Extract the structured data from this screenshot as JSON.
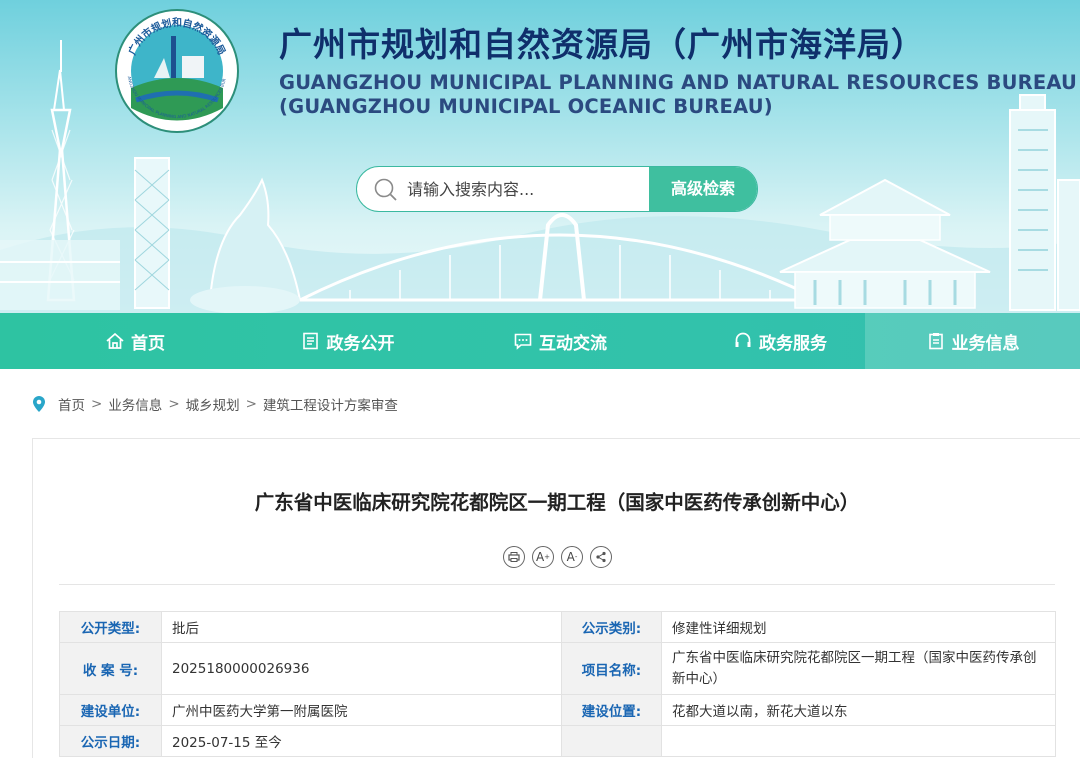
{
  "header": {
    "title_cn": "广州市规划和自然资源局（广州市海洋局）",
    "title_en_line1": "GUANGZHOU MUNICIPAL PLANNING AND NATURAL RESOURCES BUREAU",
    "title_en_line2": "(GUANGZHOU MUNICIPAL OCEANIC BUREAU)",
    "emblem_text": "广州市规划和自然资源局",
    "emblem_text_en": "GUANGZHOU MUNICIPAL PLANNING AND NATURAL RESOURCES BUREAU"
  },
  "search": {
    "placeholder": "请输入搜索内容...",
    "advanced_label": "高级检索"
  },
  "nav": {
    "items": [
      {
        "label": "首页",
        "icon": "home-icon"
      },
      {
        "label": "政务公开",
        "icon": "document-icon"
      },
      {
        "label": "互动交流",
        "icon": "chat-icon"
      },
      {
        "label": "政务服务",
        "icon": "headset-icon"
      },
      {
        "label": "业务信息",
        "icon": "clipboard-icon",
        "active": true
      }
    ]
  },
  "breadcrumb": {
    "items": [
      "首页",
      "业务信息",
      "城乡规划",
      "建筑工程设计方案审查"
    ],
    "separator": ">"
  },
  "article": {
    "title": "广东省中医临床研究院花都院区一期工程（国家中医药传承创新中心）",
    "tools": [
      "print-icon",
      "font-larger-icon",
      "font-smaller-icon",
      "share-icon"
    ],
    "tool_glyphs": {
      "font_larger": "A",
      "font_smaller": "A"
    }
  },
  "info_table": {
    "public_type_label": "公开类型:",
    "public_type_value": "批后",
    "notice_category_label": "公示类别:",
    "notice_category_value": "修建性详细规划",
    "case_no_label": "收 案 号:",
    "case_no_value": "2025180000026936",
    "project_name_label": "项目名称:",
    "project_name_value": "广东省中医临床研究院花都院区一期工程（国家中医药传承创新中心）",
    "builder_label": "建设单位:",
    "builder_value": "广州中医药大学第一附属医院",
    "location_label": "建设位置:",
    "location_value": "花都大道以南，新花大道以东",
    "notice_date_label": "公示日期:",
    "notice_date_value": "2025-07-15 至今"
  },
  "colors": {
    "nav_bg": "#31c3a9",
    "title_navy": "#0f2f6b",
    "label_blue": "#1a66b3",
    "search_button": "#3fbf9f"
  }
}
